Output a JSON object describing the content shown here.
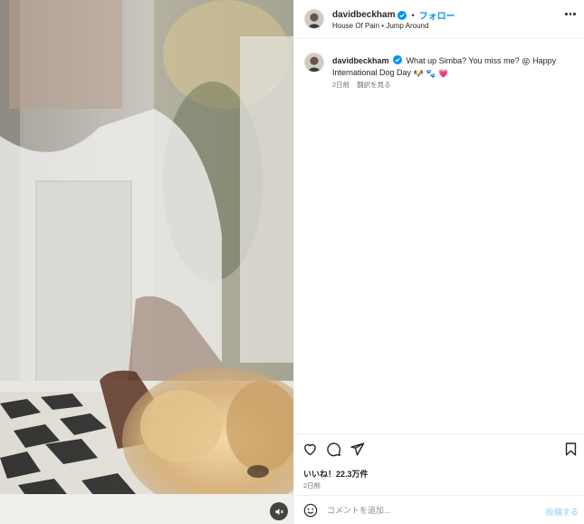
{
  "post": {
    "username": "davidbeckham",
    "follow_label": "フォロー",
    "separator": "•",
    "audio": {
      "artist": "House Of Pain",
      "separator": "•",
      "track": "Jump Around"
    },
    "caption": {
      "username": "davidbeckham",
      "text_part1": "What up Simba? You miss me?",
      "emoji1": "😝",
      "text_part2": "Happy International Dog Day",
      "emoji2": "🐶",
      "emoji3": "🐾",
      "emoji4": "💗",
      "time": "2日前",
      "see_translation": "翻訳を見る"
    },
    "likes": "いいね！22.3万件",
    "time": "2日前",
    "comment": {
      "placeholder": "コメントを追加...",
      "value": "",
      "post_label": "投稿する"
    }
  },
  "icons": {
    "header_more": "more-horizontal-icon",
    "verified": "verified-badge-icon",
    "like": "heart-icon",
    "comment": "comment-icon",
    "share": "share-icon",
    "save": "bookmark-icon",
    "emoji_picker": "emoji-icon",
    "audio": "speaker-muted-icon"
  },
  "colors": {
    "link_blue": "#0095f6",
    "verified_blue": "#0095f6",
    "secondary_text": "#737373",
    "post_disabled": "#b2dffc",
    "emoji_heart": "#e8457a"
  }
}
